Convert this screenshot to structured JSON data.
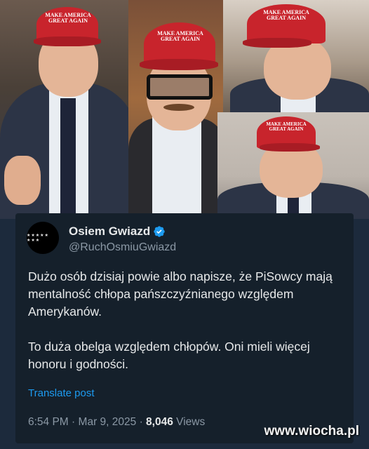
{
  "collage": {
    "cap_text": "MAKE AMERICA GREAT AGAIN"
  },
  "post": {
    "display_name": "Osiem Gwiazd",
    "handle": "@RuchOsmiuGwiazd",
    "avatar_label": "★★★★★ ★★★",
    "paragraphs": [
      "Dużo osób dzisiaj powie albo napisze, że PiSowcy mają mentalność chłopa pańszczyźnianego względem Amerykanów.",
      "To duża obelga względem chłopów. Oni mieli więcej honoru i godności."
    ],
    "translate_label": "Translate post",
    "time": "6:54 PM",
    "separator": "·",
    "date": "Mar 9, 2025",
    "views_count": "8,046",
    "views_label": "Views"
  },
  "watermark": "www.wiocha.pl",
  "colors": {
    "card_bg": "#15202b",
    "verified": "#1d9bf0",
    "cap": "#c8242c"
  }
}
